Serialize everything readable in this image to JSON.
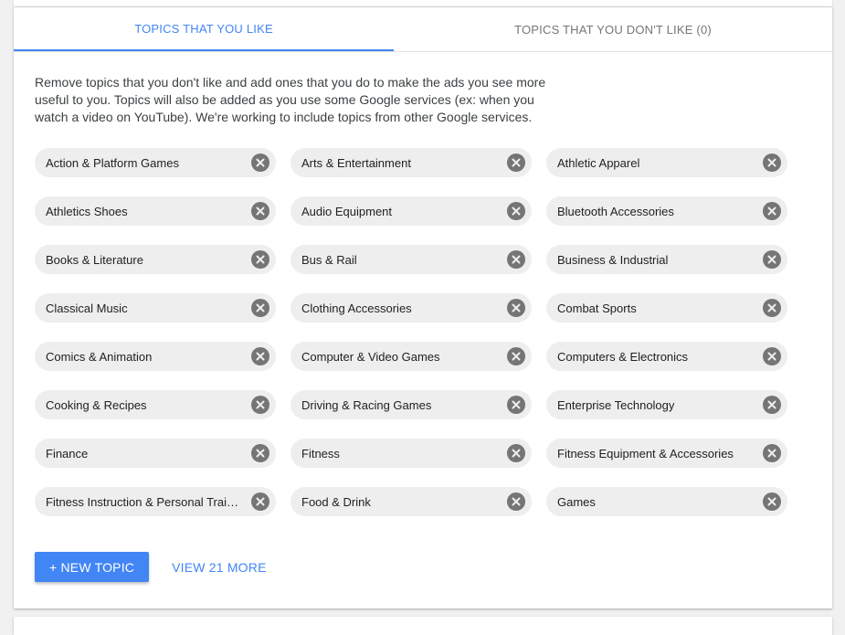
{
  "tabs": [
    {
      "label": "TOPICS THAT YOU LIKE",
      "active": true
    },
    {
      "label": "TOPICS THAT YOU DON'T LIKE (0)",
      "active": false
    }
  ],
  "description": "Remove topics that you don't like and add ones that you do to make the ads you see more useful to you. Topics will also be added as you use some Google services (ex: when you watch a video on YouTube). We're working to include topics from other Google services.",
  "topics": [
    "Action & Platform Games",
    "Arts & Entertainment",
    "Athletic Apparel",
    "Athletics Shoes",
    "Audio Equipment",
    "Bluetooth Accessories",
    "Books & Literature",
    "Bus & Rail",
    "Business & Industrial",
    "Classical Music",
    "Clothing Accessories",
    "Combat Sports",
    "Comics & Animation",
    "Computer & Video Games",
    "Computers & Electronics",
    "Cooking & Recipes",
    "Driving & Racing Games",
    "Enterprise Technology",
    "Finance",
    "Fitness",
    "Fitness Equipment & Accessories",
    "Fitness Instruction & Personal Training",
    "Food & Drink",
    "Games"
  ],
  "actions": {
    "new_topic_label": "+ NEW TOPIC",
    "view_more_label": "VIEW 21 MORE"
  },
  "icons": {
    "remove": "close-circle-icon"
  },
  "colors": {
    "accent": "#4285f4",
    "chip_bg": "#eeeeee",
    "remove_icon": "#757575"
  }
}
